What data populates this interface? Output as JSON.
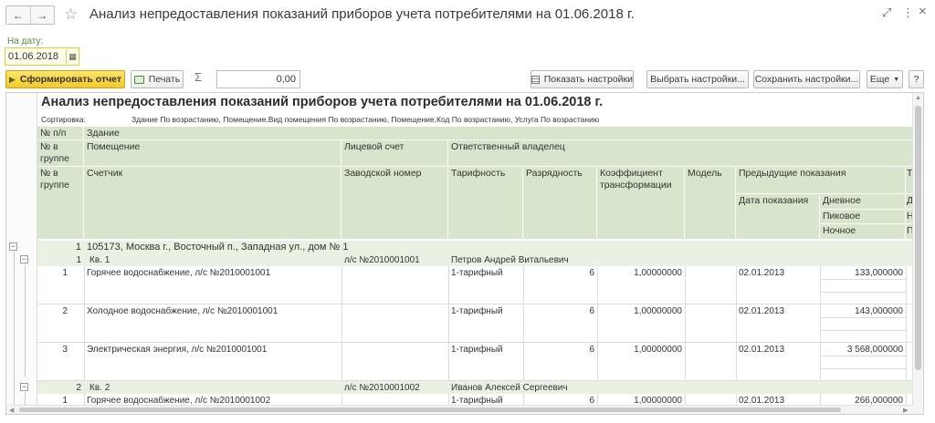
{
  "window": {
    "title": "Анализ непредоставления показаний приборов учета потребителями на 01.06.2018 г.",
    "nav_back": "←",
    "nav_forward": "→",
    "star": "☆",
    "btn_link": "⤢",
    "btn_more": "⋮",
    "btn_close": "×"
  },
  "params": {
    "date_label": "На дату:",
    "date_value": "01.06.2018",
    "calendar_glyph": "▦"
  },
  "toolbar": {
    "generate_label": "Сформировать отчет",
    "print_label": "Печать",
    "sigma": "Σ",
    "sum_value": "0,00",
    "show_settings_label": "Показать настройки",
    "choose_settings_label": "Выбрать настройки...",
    "save_settings_label": "Сохранить настройки...",
    "more_label": "Еще",
    "help_label": "?"
  },
  "report": {
    "title": "Анализ непредоставления показаний приборов учета потребителями на 01.06.2018 г.",
    "sort_label": "Сортировка:",
    "sort_value": "Здание По возрастанию, Помещение.Вид помещения По возрастанию, Помещение.Код По возрастанию, Услуга По возрастанию",
    "headers": {
      "num": "№ п/п",
      "building": "Здание",
      "num_in_group": "№ в группе",
      "premises": "Помещение",
      "account": "Лицевой счет",
      "owner": "Ответственный владелец",
      "num_in_group2": "№ в группе",
      "meter": "Счетчик",
      "serial": "Заводской номер",
      "tariff": "Тарифность",
      "capacity": "Разрядность",
      "coefficient": "Коэффициент трансформации",
      "model": "Модель",
      "previous": "Предыдущие показания",
      "reading_date": "Дата показания",
      "day": "Дневное",
      "peak": "Пиковое",
      "night": "Ночное",
      "cut_te": "Те",
      "cut_po": "по",
      "cut_d": "Д",
      "cut_n": "Н",
      "cut_p": "П"
    },
    "building": {
      "num": "1",
      "address": "105173, Москва г., Восточный п., Западная ул., дом № 1"
    },
    "groups": [
      {
        "num": "1",
        "name": "Кв. 1",
        "account": "л/с №2010001001",
        "owner": "Петров Андрей Витальевич",
        "rows": [
          {
            "num": "1",
            "meter": "Горячее водоснабжение, л/с №2010001001",
            "tariff": "1-тарифный",
            "capacity": "6",
            "coef": "1,00000000",
            "date": "02.01.2013",
            "day": "133,000000"
          },
          {
            "num": "2",
            "meter": "Холодное водоснабжение, л/с №2010001001",
            "tariff": "1-тарифный",
            "capacity": "6",
            "coef": "1,00000000",
            "date": "02.01.2013",
            "day": "143,000000"
          },
          {
            "num": "3",
            "meter": "Электрическая энергия, л/с №2010001001",
            "tariff": "1-тарифный",
            "capacity": "6",
            "coef": "1,00000000",
            "date": "02.01.2013",
            "day": "3 568,000000"
          }
        ]
      },
      {
        "num": "2",
        "name": "Кв. 2",
        "account": "л/с №2010001002",
        "owner": "Иванов Алексей Сергеевич",
        "rows": [
          {
            "num": "1",
            "meter": "Горячее водоснабжение, л/с №2010001002",
            "tariff": "1-тарифный",
            "capacity": "6",
            "coef": "1,00000000",
            "date": "02.01.2013",
            "day": "266,000000"
          }
        ]
      }
    ]
  }
}
